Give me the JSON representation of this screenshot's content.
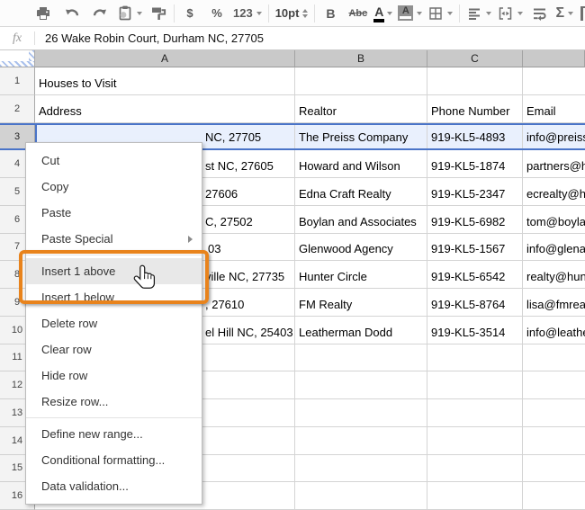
{
  "toolbar": {
    "currency_label": "$",
    "percent_label": "%",
    "number_format_label": "123",
    "font_size_value": "10pt",
    "bold_label": "B",
    "strikethrough_label": "Abc",
    "text_color_label": "A",
    "fill_color_label": "A",
    "functions_label": "Σ"
  },
  "formula_bar": {
    "fx_label": "fx",
    "value": "26 Wake Robin Court, Durham NC, 27705"
  },
  "grid": {
    "column_headers": [
      "A",
      "B",
      "C"
    ],
    "row_numbers": [
      "1",
      "2",
      "3",
      "4",
      "5",
      "6",
      "7",
      "8",
      "9",
      "10",
      "11",
      "12",
      "13",
      "14",
      "15",
      "16"
    ],
    "title_cell": "Houses to Visit",
    "header_cells": {
      "address": "Address",
      "realtor": "Realtor",
      "phone": "Phone Number",
      "email": "Email"
    },
    "selected_row_number": "3",
    "records": [
      {
        "address_fragment": "NC, 27705",
        "realtor": "The Preiss Company",
        "phone": "919-KL5-4893",
        "email": "info@preiss"
      },
      {
        "address_fragment": "st NC, 27605",
        "realtor": "Howard and Wilson",
        "phone": "919-KL5-1874",
        "email": "partners@ho"
      },
      {
        "address_fragment": "27606",
        "realtor": "Edna Craft Realty",
        "phone": "919-KL5-2347",
        "email": "ecrealty@ho"
      },
      {
        "address_fragment": "C, 27502",
        "realtor": "Boylan and Associates",
        "phone": "919-KL5-6982",
        "email": "tom@boylan"
      },
      {
        "address_fragment": "03",
        "realtor": "Glenwood Agency",
        "phone": "919-KL5-1567",
        "email": "info@glenag"
      },
      {
        "address_fragment": "ville NC, 27735",
        "realtor": "Hunter Circle",
        "phone": "919-KL5-6542",
        "email": "realty@hunt"
      },
      {
        "address_fragment": ", 27610",
        "realtor": "FM Realty",
        "phone": "919-KL5-8764",
        "email": "lisa@fmreal"
      },
      {
        "address_fragment": "el Hill NC, 25403",
        "realtor": "Leatherman Dodd",
        "phone": "919-KL5-3514",
        "email": "info@leathe"
      }
    ]
  },
  "context_menu": {
    "items": [
      {
        "label": "Cut"
      },
      {
        "label": "Copy"
      },
      {
        "label": "Paste"
      },
      {
        "label": "Paste Special",
        "has_submenu": true
      },
      {
        "label": "Insert 1 above",
        "hovered": true
      },
      {
        "label": "Insert 1 below"
      },
      {
        "label": "Delete row"
      },
      {
        "label": "Clear row"
      },
      {
        "label": "Hide row"
      },
      {
        "label": "Resize row..."
      },
      {
        "label": "Define new range..."
      },
      {
        "label": "Conditional formatting..."
      },
      {
        "label": "Data validation..."
      }
    ]
  },
  "callout": {
    "highlight_color": "#E8831C"
  },
  "colors": {
    "selection_fill": "#E9F0FD",
    "selection_border": "#4A74C8",
    "column_header_bg": "#C9C9C9",
    "menu_hover": "#E8E8E8"
  }
}
